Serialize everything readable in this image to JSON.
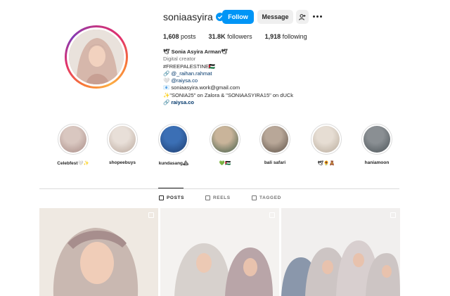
{
  "profile": {
    "username": "soniaasyira",
    "verified": true,
    "accent": "#0095f6",
    "follow_label": "Follow",
    "message_label": "Message",
    "adduser_icon": "add-user-icon",
    "more_icon": "more-icon"
  },
  "stats": {
    "posts_count": "1,608",
    "posts_label": " posts",
    "followers_count": "31.8K",
    "followers_label": " followers",
    "following_count": "1,918",
    "following_label": " following"
  },
  "bio": {
    "name": "🕊 Sonia Asyira Arman🕊",
    "category": "Digital creator",
    "line1": "#FREEPALESTINE🇵🇸",
    "line2_prefix": "🔗 ",
    "line2": "@_raihan.rahmat",
    "line3_prefix": "🤍 ",
    "line3": "@raiysa.co",
    "line4": "📧 soniaasyira.work@gmail.com",
    "line5": "✨\"SONIA25\" on Zalora & \"SONIAASYIRA15\" on dUCk",
    "link_prefix": "🔗 ",
    "link": "raiysa.co"
  },
  "highlights": [
    {
      "label": "Celebfest🤍✨",
      "colors": [
        "#d9c7c0",
        "#a88b86"
      ]
    },
    {
      "label": "shopeebuys",
      "colors": [
        "#e8dfd8",
        "#b9a79b"
      ]
    },
    {
      "label": "kundasang🏔",
      "colors": [
        "#3b6fb5",
        "#1d3c6e"
      ]
    },
    {
      "label": "💚🇵🇸",
      "colors": [
        "#c9b49a",
        "#3e5a45"
      ]
    },
    {
      "label": "bali safari",
      "colors": [
        "#b8a798",
        "#5c5046"
      ]
    },
    {
      "label": "🕊🌻🧸",
      "colors": [
        "#e6ddd3",
        "#b7aa9a"
      ]
    },
    {
      "label": "haniamoon",
      "colors": [
        "#8a8f93",
        "#4b5357"
      ]
    }
  ],
  "tabs": [
    {
      "label": "POSTS",
      "icon": "grid-icon",
      "active": true
    },
    {
      "label": "REELS",
      "icon": "reels-icon",
      "active": false
    },
    {
      "label": "TAGGED",
      "icon": "tagged-icon",
      "active": false
    }
  ],
  "posts": [
    {
      "colors": [
        "#efe9e2",
        "#c9b8b1",
        "#a78e8d"
      ]
    },
    {
      "colors": [
        "#f4f2f0",
        "#d7d1cd",
        "#b9a5a8"
      ]
    },
    {
      "colors": [
        "#f1efee",
        "#cdc5c4",
        "#8a97ab"
      ]
    }
  ]
}
